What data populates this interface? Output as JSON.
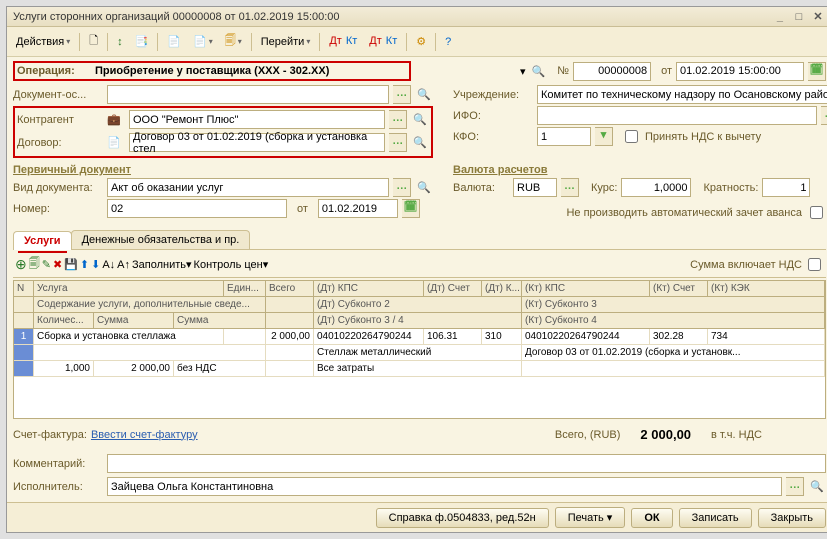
{
  "window": {
    "title": "Услуги сторонних организаций 00000008 от 01.02.2019 15:00:00"
  },
  "toolbar": {
    "actions": "Действия",
    "goto": "Перейти"
  },
  "operation": {
    "label": "Операция:",
    "value": "Приобретение у поставщика (XXX - 302.XX)",
    "num_label": "№",
    "num": "00000008",
    "date_label": "от",
    "date": "01.02.2019 15:00:00"
  },
  "left": {
    "doc_os_label": "Документ-ос...",
    "doc_os": "",
    "contragent_label": "Контрагент",
    "contragent": "ООО \"Ремонт Плюс\"",
    "dogovor_label": "Договор:",
    "dogovor": "Договор 03 от 01.02.2019 (сборка и установка стел"
  },
  "right": {
    "uchr_label": "Учреждение:",
    "uchr": "Комитет по техническому надзору по Осановскому район",
    "ifo_label": "ИФО:",
    "ifo": "",
    "kfo_label": "КФО:",
    "kfo": "1",
    "nds_accept": "Принять НДС к вычету"
  },
  "sections": {
    "primary": "Первичный документ",
    "currency": "Валюта расчетов"
  },
  "pd": {
    "vid_label": "Вид документа:",
    "vid": "Акт об оказании услуг",
    "nomer_label": "Номер:",
    "nomer": "02",
    "ot": "от",
    "date": "01.02.2019"
  },
  "val": {
    "label": "Валюта:",
    "code": "RUB",
    "kurs_label": "Курс:",
    "kurs": "1,0000",
    "krat_label": "Кратность:",
    "krat": "1"
  },
  "flags": {
    "no_avans": "Не производить автоматический зачет аванса",
    "sum_incl_nds": "Сумма включает НДС"
  },
  "tabs": {
    "t1": "Услуги",
    "t2": "Денежные обязательства и пр."
  },
  "sub": {
    "fill": "Заполнить",
    "price_ctrl": "Контроль цен"
  },
  "grid": {
    "h": {
      "n": "N",
      "usluga": "Услуга",
      "edin": "Един...",
      "vsego": "Всего",
      "dt_kps": "(Дт) КПС",
      "dt_schet": "(Дт) Счет",
      "dt_k": "(Дт) К...",
      "kt_kps": "(Кт) КПС",
      "kt_schet": "(Кт) Счет",
      "kt_kek": "(Кт) КЭК",
      "sod": "Содержание услуги, дополнительные сведе...",
      "dt_sub2": "(Дт) Субконто 2",
      "kt_sub3": "(Кт) Субконто 3",
      "kol": "Количес...",
      "summa": "Сумма",
      "summa2": "Сумма",
      "dt_sub34": "(Дт) Субконто 3 / 4",
      "kt_sub4": "(Кт) Субконто 4"
    },
    "r": {
      "n": "1",
      "usluga": "Сборка и установка стеллажа",
      "vsego": "2 000,00",
      "dt_kps": "04010220264790244",
      "dt_schet": "106.31",
      "dt_k": "310",
      "kt_kps": "04010220264790244",
      "kt_schet": "302.28",
      "kt_kek": "734",
      "dt_sub2_val": "Стеллаж  металлический",
      "kt_sub3_val": "Договор 03 от 01.02.2019 (сборка и установк...",
      "kol": "1,000",
      "summa": "2 000,00",
      "bez_nds": "без НДС",
      "dt_sub34_val": "Все затраты"
    }
  },
  "totals": {
    "sf_label": "Счет-фактура:",
    "sf_link": "Ввести счет-фактуру",
    "vsego_label": "Всего, (RUB)",
    "vsego": "2 000,00",
    "vtch": "в т.ч. НДС"
  },
  "bottom": {
    "komm_label": "Комментарий:",
    "komm": "",
    "isp_label": "Исполнитель:",
    "isp": "Зайцева Ольга Константиновна"
  },
  "footer": {
    "spravka": "Справка ф.0504833, ред.52н",
    "pechat": "Печать",
    "ok": "ОК",
    "zapisat": "Записать",
    "zakryt": "Закрыть"
  }
}
